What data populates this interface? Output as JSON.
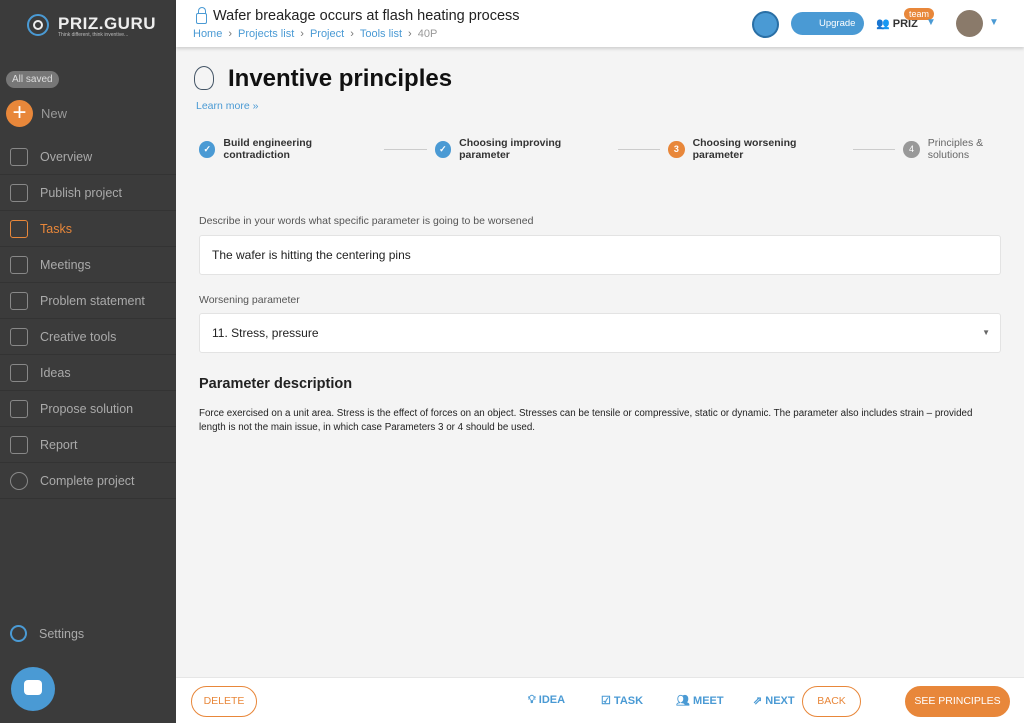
{
  "sidebar": {
    "logo": "PRIZ.GURU",
    "tagline": "Think different, think inventive...",
    "status": "All saved",
    "new_label": "New",
    "items": [
      {
        "label": "Overview"
      },
      {
        "label": "Publish project"
      },
      {
        "label": "Tasks"
      },
      {
        "label": "Meetings"
      },
      {
        "label": "Problem statement"
      },
      {
        "label": "Creative tools"
      },
      {
        "label": "Ideas"
      },
      {
        "label": "Propose solution"
      },
      {
        "label": "Report"
      },
      {
        "label": "Complete project"
      }
    ],
    "settings": "Settings"
  },
  "header": {
    "title": "Wafer breakage occurs at flash heating process",
    "breadcrumb": [
      "Home",
      "Projects list",
      "Project",
      "Tools list",
      "40P"
    ],
    "upgrade": "Upgrade",
    "team_name": "PRIZ",
    "team_badge": "team"
  },
  "page": {
    "title": "Inventive principles",
    "learn_more": "Learn more »",
    "steps": [
      {
        "num": "✓",
        "label": "Build engineering contradiction",
        "state": "done"
      },
      {
        "num": "✓",
        "label": "Choosing improving parameter",
        "state": "done"
      },
      {
        "num": "3",
        "label": "Choosing worsening parameter",
        "state": "active"
      },
      {
        "num": "4",
        "label": "Principles & solutions",
        "state": "todo"
      }
    ],
    "describe_label": "Describe in your words what specific parameter is going to be worsened",
    "describe_value": "The wafer is hitting the centering pins",
    "worsening_label": "Worsening parameter",
    "worsening_value": "11. Stress, pressure",
    "desc_title": "Parameter description",
    "desc_text": "Force exercised on a unit area. Stress is the effect of forces on an object. Stresses can be tensile or compressive, static or dynamic. The parameter also includes strain – provided length is not the main issue, in which case Parameters 3 or 4 should be used."
  },
  "footer": {
    "delete": "DELETE",
    "idea": "IDEA",
    "task": "TASK",
    "meet": "MEET",
    "next": "NEXT",
    "back": "BACK",
    "see": "SEE PRINCIPLES"
  },
  "colors": {
    "accent": "#e8873a",
    "primary": "#4a9ad4"
  }
}
